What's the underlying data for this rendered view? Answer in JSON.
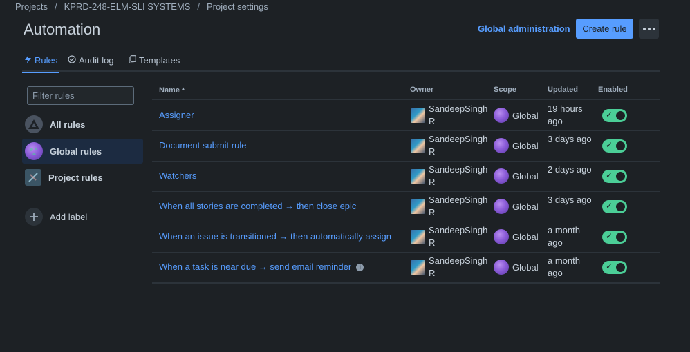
{
  "breadcrumb": [
    "Projects",
    "KPRD-248-ELM-SLI SYSTEMS",
    "Project settings"
  ],
  "page_title": "Automation",
  "header": {
    "global_admin": "Global administration",
    "create_rule": "Create rule"
  },
  "tabs": [
    {
      "label": "Rules",
      "icon": "lightning-icon"
    },
    {
      "label": "Audit log",
      "icon": "check-circle-icon"
    },
    {
      "label": "Templates",
      "icon": "copy-icon"
    }
  ],
  "filter": {
    "placeholder": "Filter rules",
    "value": ""
  },
  "sidebar": {
    "items": [
      {
        "label": "All rules",
        "icon": "all-rules-icon"
      },
      {
        "label": "Global rules",
        "icon": "globe-icon"
      },
      {
        "label": "Project rules",
        "icon": "project-icon"
      },
      {
        "label": "Add label",
        "icon": "plus-icon"
      }
    ]
  },
  "table": {
    "columns": [
      "Name",
      "Owner",
      "Scope",
      "Updated",
      "Enabled"
    ],
    "rows": [
      {
        "name": "Assigner",
        "owner": "SandeepSingh R",
        "scope": "Global",
        "updated": "19 hours ago",
        "enabled": true
      },
      {
        "name": "Document submit rule",
        "owner": "SandeepSingh R",
        "scope": "Global",
        "updated": "3 days ago",
        "enabled": true
      },
      {
        "name": "Watchers",
        "owner": "SandeepSingh R",
        "scope": "Global",
        "updated": "2 days ago",
        "enabled": true
      },
      {
        "name": "When all stories are completed → then close epic",
        "owner": "SandeepSingh R",
        "scope": "Global",
        "updated": "3 days ago",
        "enabled": true
      },
      {
        "name": "When an issue is transitioned → then automatically assign",
        "owner": "SandeepSingh R",
        "scope": "Global",
        "updated": "a month ago",
        "enabled": true
      },
      {
        "name": "When a task is near due → send email reminder",
        "owner": "SandeepSingh R",
        "scope": "Global",
        "updated": "a month ago",
        "enabled": true
      }
    ]
  },
  "colors": {
    "background": "#1d2125",
    "accent": "#579dff",
    "toggle_on": "#4bce97",
    "active_nav": "#1c2b41"
  }
}
